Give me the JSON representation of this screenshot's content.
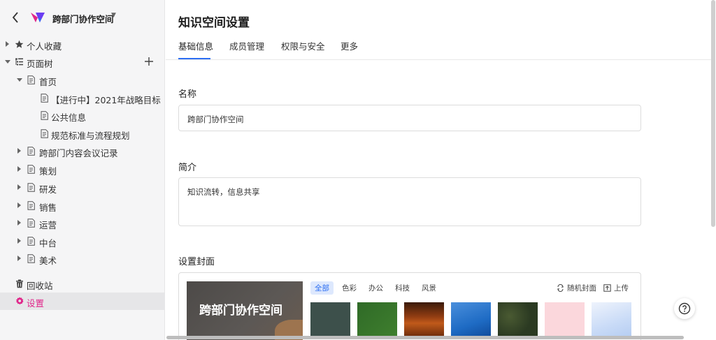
{
  "sidebar": {
    "space_name": "跨部门协作空间",
    "items": [
      {
        "label": "个人收藏"
      },
      {
        "label": "页面树"
      },
      {
        "label": "首页"
      },
      {
        "label": "【进行中】2021年战略目标"
      },
      {
        "label": "公共信息"
      },
      {
        "label": "规范标准与流程规划"
      },
      {
        "label": "跨部门内容会议记录"
      },
      {
        "label": "策划"
      },
      {
        "label": "研发"
      },
      {
        "label": "销售"
      },
      {
        "label": "运营"
      },
      {
        "label": "中台"
      },
      {
        "label": "美术"
      },
      {
        "label": "回收站"
      },
      {
        "label": "设置"
      }
    ]
  },
  "main": {
    "title": "知识空间设置",
    "tabs": [
      {
        "label": "基础信息"
      },
      {
        "label": "成员管理"
      },
      {
        "label": "权限与安全"
      },
      {
        "label": "更多"
      }
    ],
    "name_label": "名称",
    "name_value": "跨部门协作空间",
    "intro_label": "简介",
    "intro_value": "知识流转，信息共享",
    "cover_label": "设置封面",
    "cover": {
      "preview_title": "跨部门协作空间",
      "categories": [
        "全部",
        "色彩",
        "办公",
        "科技",
        "风景"
      ],
      "random_label": "随机封面",
      "upload_label": "上传",
      "thumbnails": [
        {
          "color": "#3d504b"
        },
        {
          "color": "#2f6a27"
        },
        {
          "color": "#8f3c12"
        },
        {
          "color": "#1e6bc4"
        },
        {
          "color": "#2b3a22"
        },
        {
          "color": "#fbd7dc"
        },
        {
          "color": "#c9dbf7"
        }
      ]
    }
  },
  "colors": {
    "accent": "#e0268a",
    "primary": "#2c6ef2"
  }
}
